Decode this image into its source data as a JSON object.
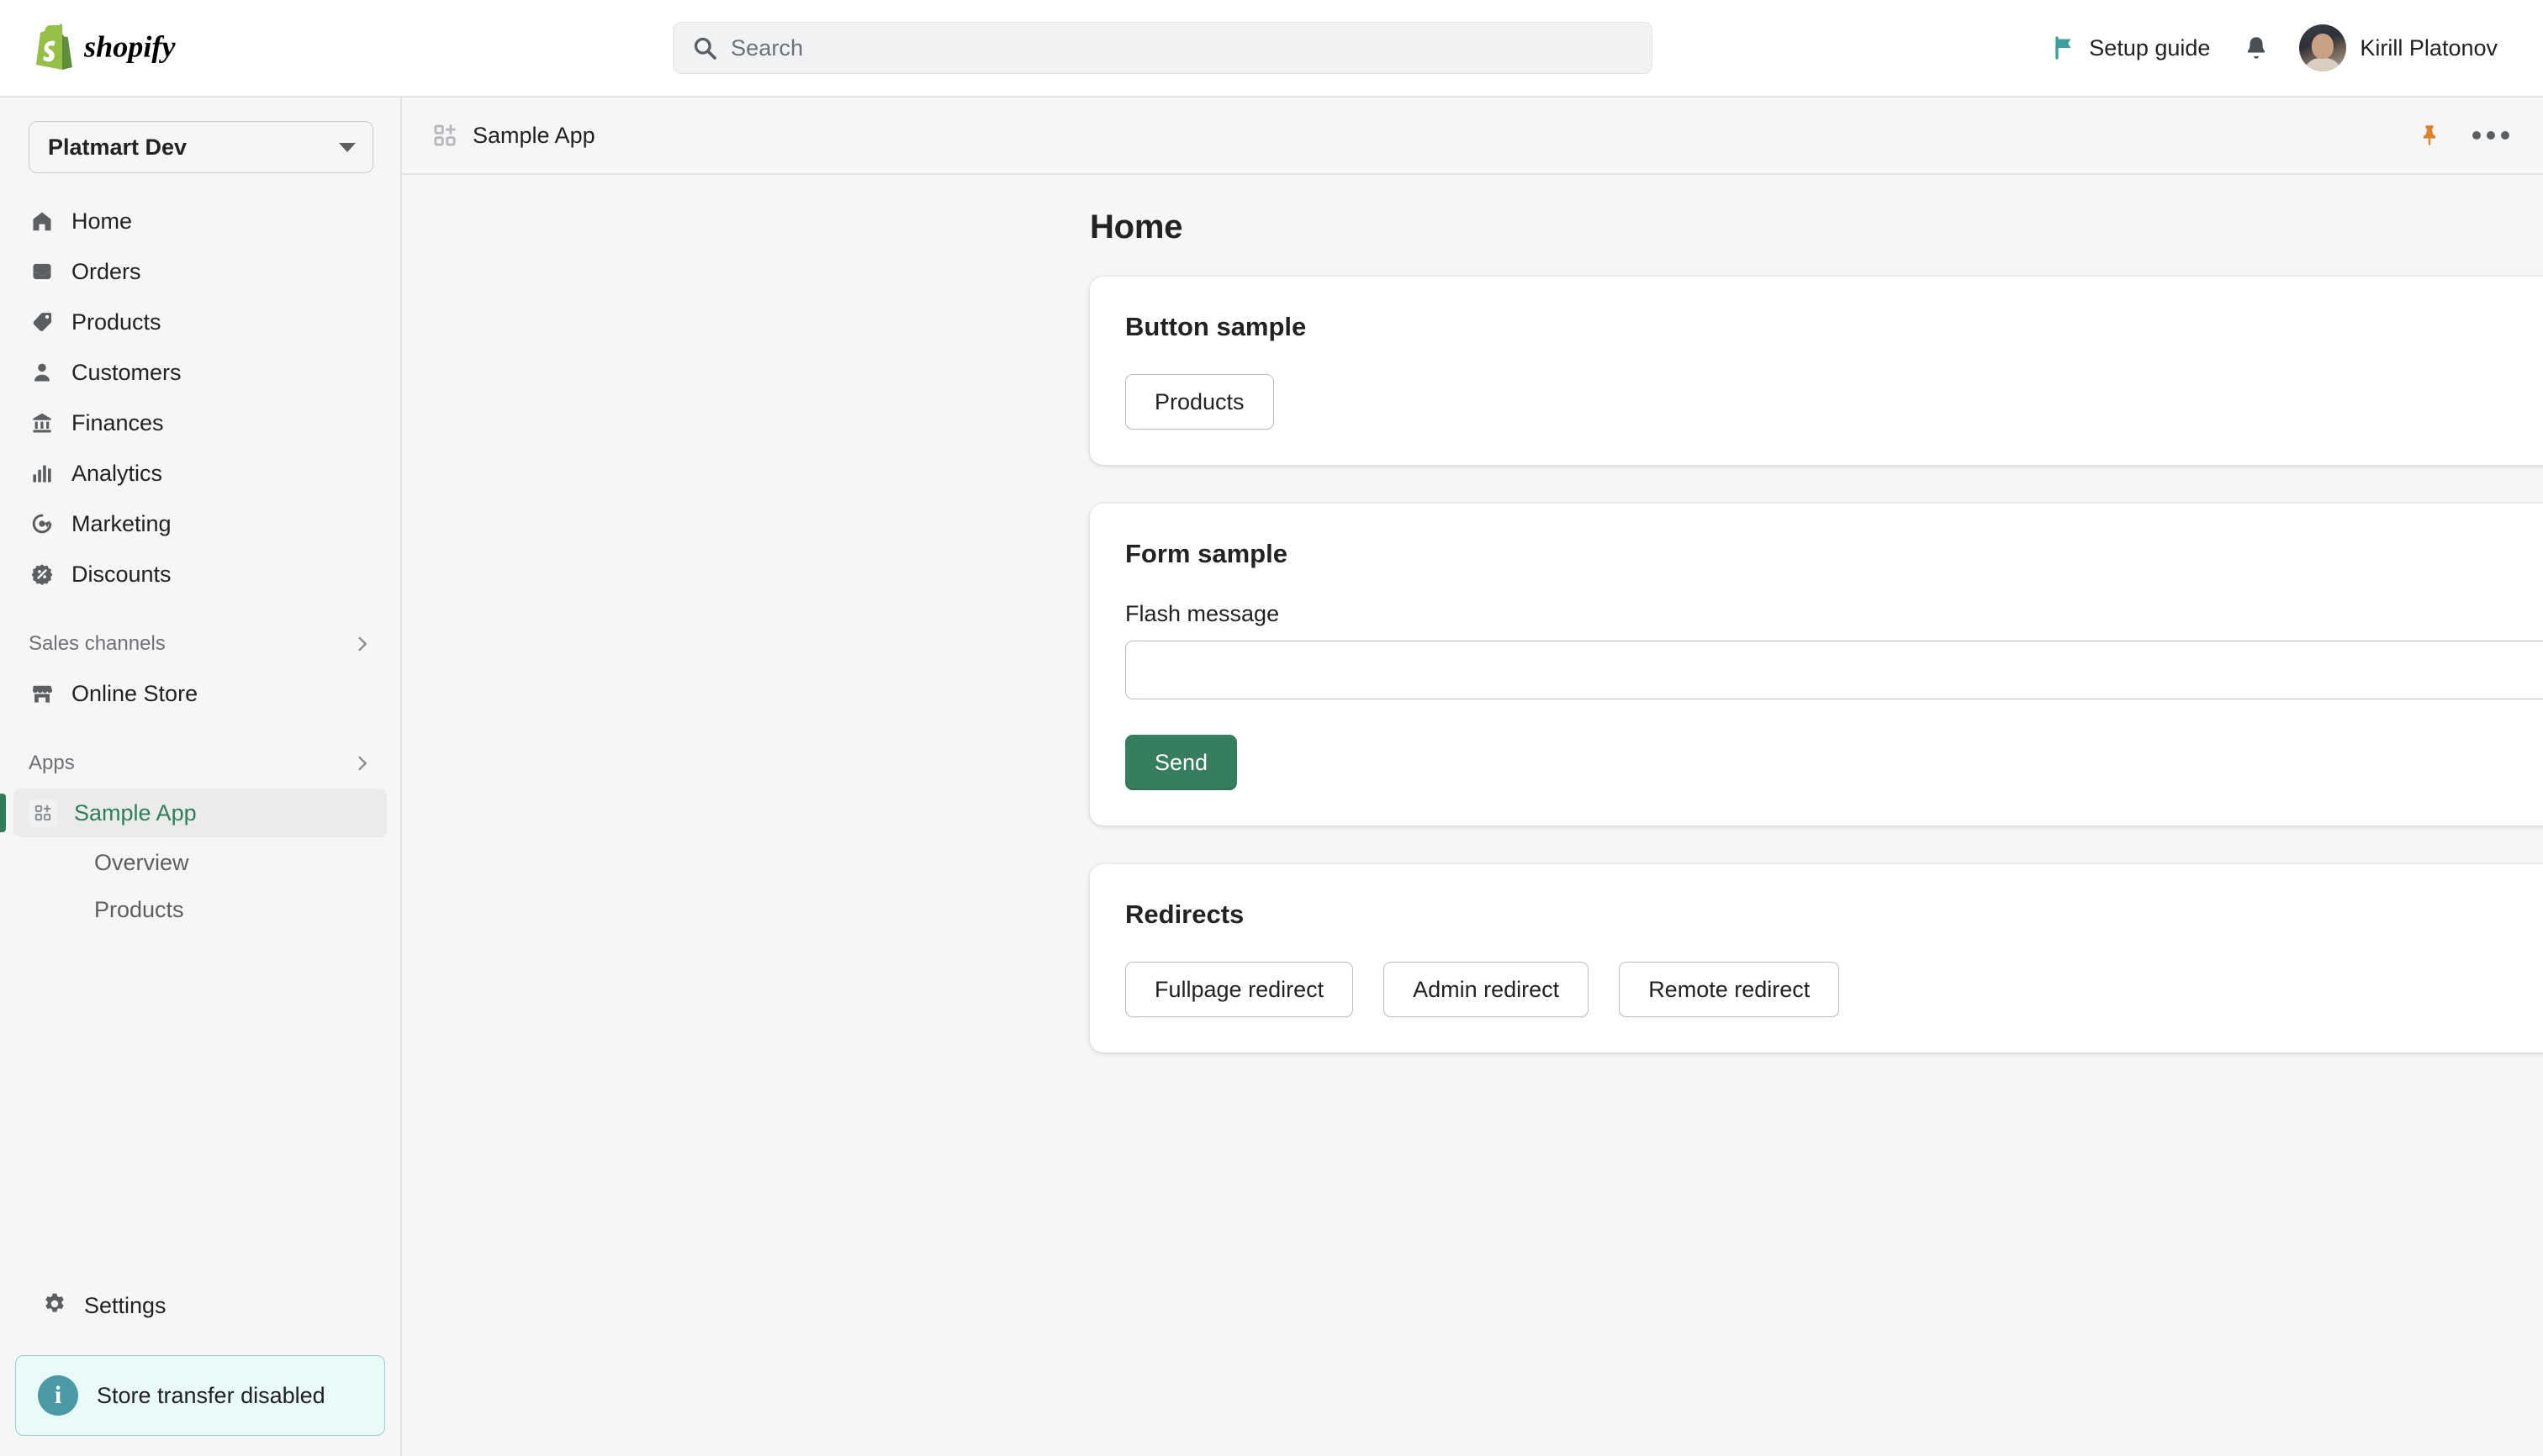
{
  "topbar": {
    "logo_text": "shopify",
    "search": {
      "placeholder": "Search",
      "value": "",
      "icon": "search-icon"
    },
    "setup_guide_label": "Setup guide",
    "setup_guide_icon": "flag-icon",
    "notifications_icon": "bell-icon",
    "user_name": "Kirill Platonov",
    "avatar_icon": "avatar"
  },
  "sidebar": {
    "store_selector": {
      "label": "Platmart Dev",
      "icon": "chevron-down-icon"
    },
    "items": [
      {
        "label": "Home",
        "icon": "home-icon"
      },
      {
        "label": "Orders",
        "icon": "orders-icon"
      },
      {
        "label": "Products",
        "icon": "tag-icon"
      },
      {
        "label": "Customers",
        "icon": "person-icon"
      },
      {
        "label": "Finances",
        "icon": "bank-icon"
      },
      {
        "label": "Analytics",
        "icon": "chart-icon"
      },
      {
        "label": "Marketing",
        "icon": "target-icon"
      },
      {
        "label": "Discounts",
        "icon": "discount-icon"
      }
    ],
    "sales_channels": {
      "title": "Sales channels",
      "expand_icon": "chevron-right-icon",
      "items": [
        {
          "label": "Online Store",
          "icon": "storefront-icon"
        }
      ]
    },
    "apps": {
      "title": "Apps",
      "expand_icon": "chevron-right-icon",
      "active_app": {
        "label": "Sample App",
        "icon": "apps-grid-icon"
      },
      "sub_items": [
        {
          "label": "Overview"
        },
        {
          "label": "Products"
        }
      ]
    },
    "settings": {
      "label": "Settings",
      "icon": "gear-icon"
    },
    "banner": {
      "text": "Store transfer disabled",
      "icon": "info-icon"
    }
  },
  "appbar": {
    "title": "Sample App",
    "icon": "apps-grid-icon",
    "pin_icon": "pin-icon",
    "more_icon": "more-horizontal-icon"
  },
  "main": {
    "page_title": "Home",
    "cards": [
      {
        "title": "Button sample",
        "buttons": [
          {
            "label": "Products",
            "style": "secondary"
          }
        ]
      },
      {
        "title": "Form sample",
        "field_label": "Flash message",
        "field_value": "",
        "field_placeholder": "",
        "submit_label": "Send"
      },
      {
        "title": "Redirects",
        "buttons": [
          {
            "label": "Fullpage redirect",
            "style": "secondary"
          },
          {
            "label": "Admin redirect",
            "style": "secondary"
          },
          {
            "label": "Remote redirect",
            "style": "secondary"
          }
        ]
      }
    ]
  },
  "colors": {
    "brand_green": "#377e5f",
    "active_green": "#2e7d5b",
    "page_bg": "#f6f6f7",
    "card_bg": "#ffffff",
    "border": "#e1e3e5",
    "teal": "#4a9aa5",
    "pin_orange": "#d9822b"
  }
}
